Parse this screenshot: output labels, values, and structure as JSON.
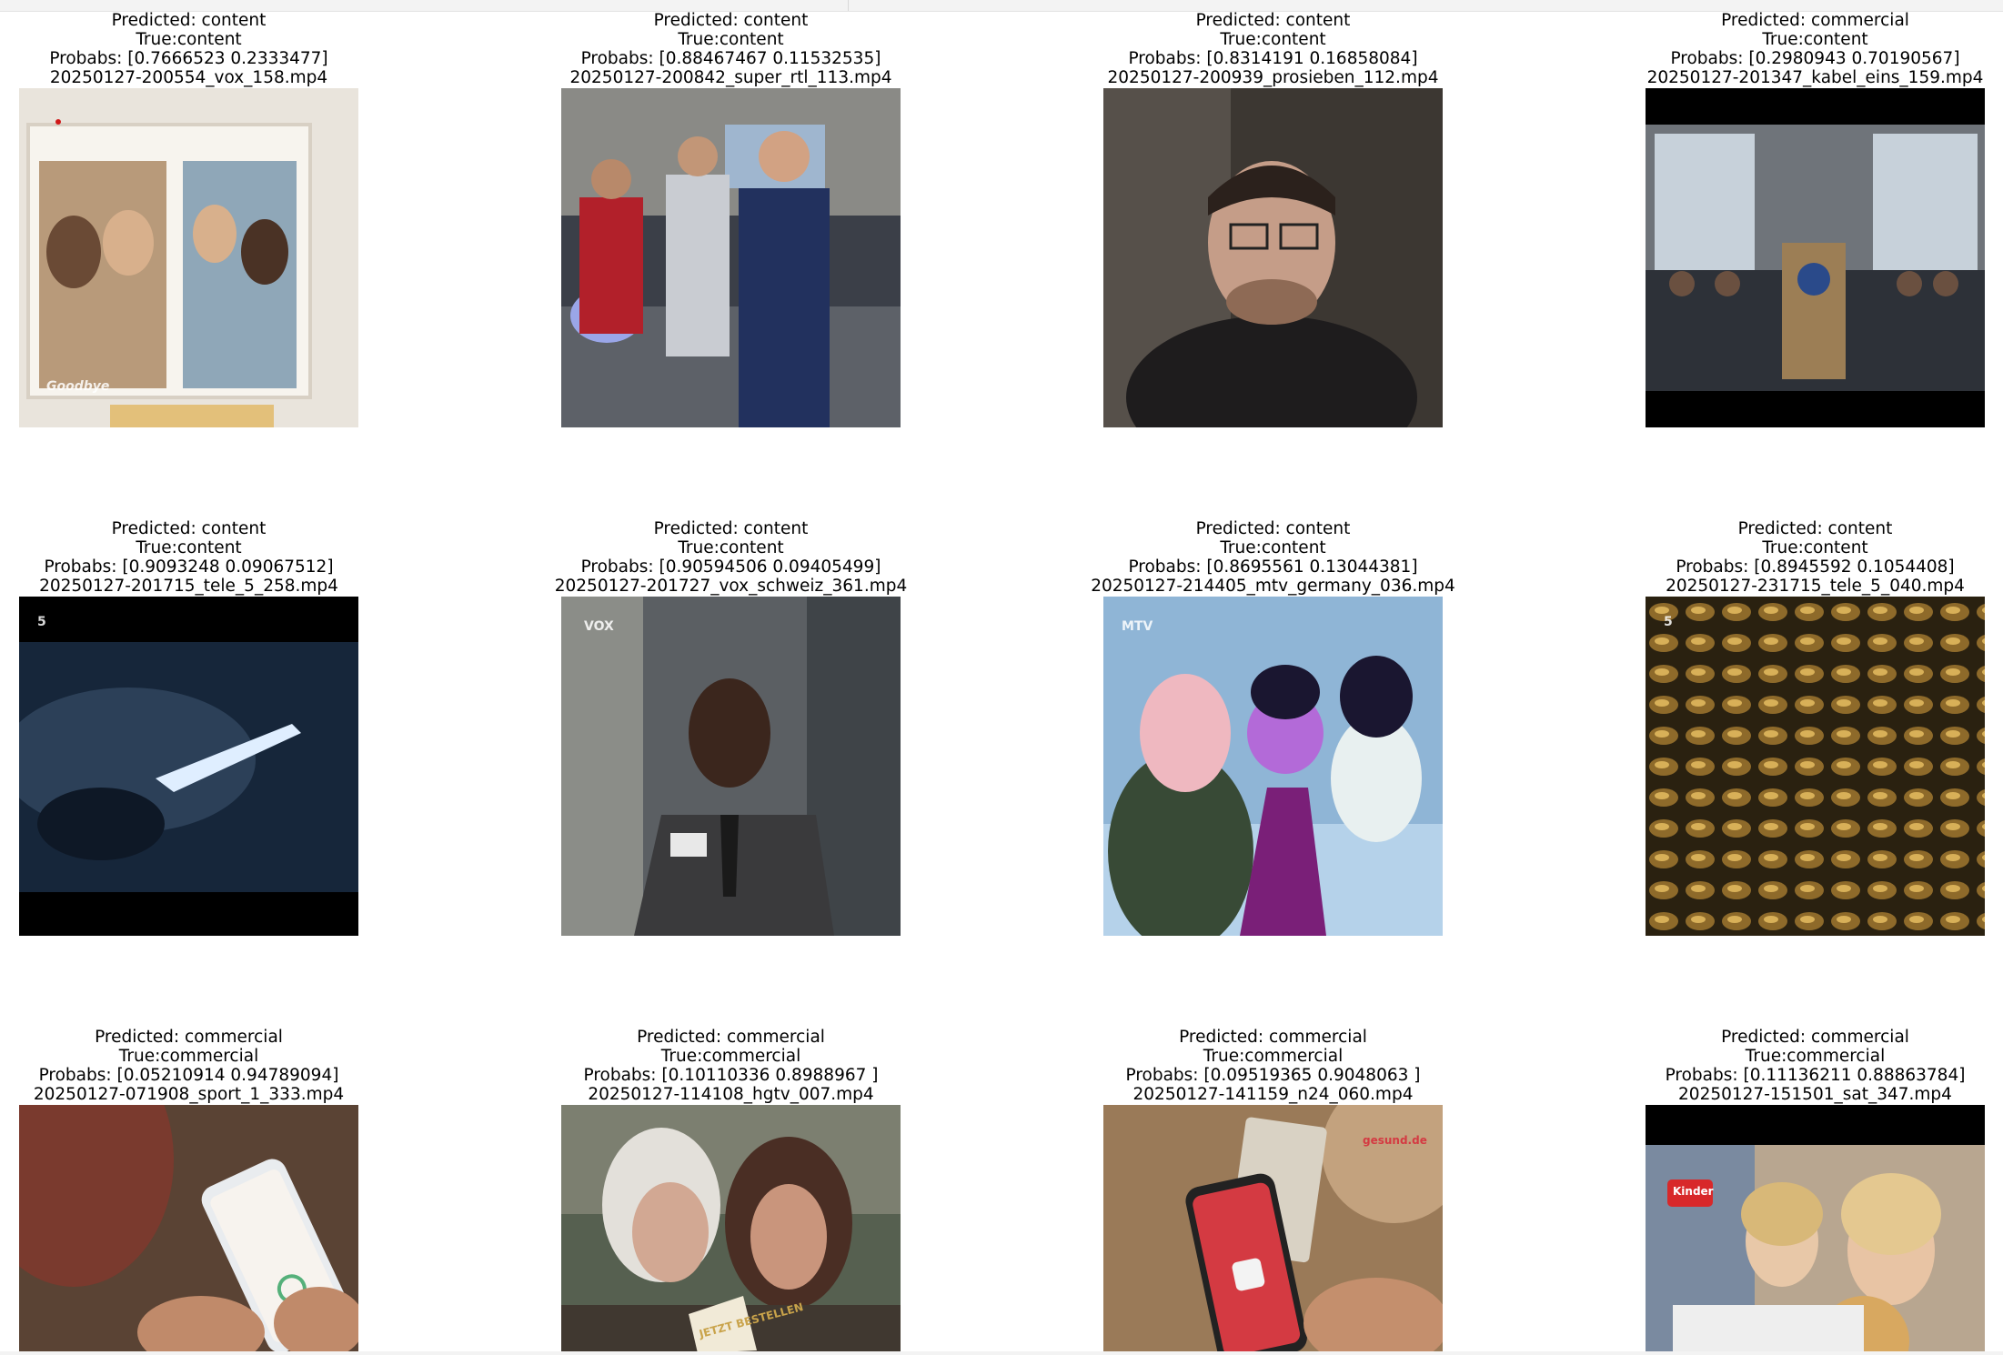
{
  "grid": [
    {
      "predicted": "Predicted: content",
      "true_label": "True:content",
      "probabs": "Probabs: [0.7666523 0.2333477]",
      "filename": "20250127-200554_vox_158.mp4",
      "scene": "photo-frame"
    },
    {
      "predicted": "Predicted: content",
      "true_label": "True:content",
      "probabs": "Probabs: [0.88467467 0.11532535]",
      "filename": "20250127-200842_super_rtl_113.mp4",
      "scene": "lab-three-people"
    },
    {
      "predicted": "Predicted: content",
      "true_label": "True:content",
      "probabs": "Probabs: [0.8314191  0.16858084]",
      "filename": "20250127-200939_prosieben_112.mp4",
      "scene": "man-glasses-portrait"
    },
    {
      "predicted": "Predicted: commercial",
      "true_label": "True:content",
      "probabs": "Probabs: [0.2980943  0.70190567]",
      "filename": "20250127-201347_kabel_eins_159.mp4",
      "scene": "press-conference"
    },
    {
      "predicted": "Predicted: content",
      "true_label": "True:content",
      "probabs": "Probabs: [0.9093248  0.09067512]",
      "filename": "20250127-201715_tele_5_258.mp4",
      "scene": "dark-beam"
    },
    {
      "predicted": "Predicted: content",
      "true_label": "True:content",
      "probabs": "Probabs: [0.90594506 0.09405499]",
      "filename": "20250127-201727_vox_schweiz_361.mp4",
      "scene": "man-suit-id-card"
    },
    {
      "predicted": "Predicted: content",
      "true_label": "True:content",
      "probabs": "Probabs: [0.8695561  0.13044381]",
      "filename": "20250127-214405_mtv_germany_036.mp4",
      "scene": "cartoon"
    },
    {
      "predicted": "Predicted: content",
      "true_label": "True:content",
      "probabs": "Probabs: [0.8945592 0.1054408]",
      "filename": "20250127-231715_tele_5_040.mp4",
      "scene": "gold-pattern"
    },
    {
      "predicted": "Predicted: commercial",
      "true_label": "True:commercial",
      "probabs": "Probabs: [0.05210914 0.94789094]",
      "filename": "20250127-071908_sport_1_333.mp4",
      "scene": "phone-in-hand"
    },
    {
      "predicted": "Predicted: commercial",
      "true_label": "True:commercial",
      "probabs": "Probabs: [0.10110336 0.8988967 ]",
      "filename": "20250127-114108_hgtv_007.mp4",
      "scene": "two-women"
    },
    {
      "predicted": "Predicted: commercial",
      "true_label": "True:commercial",
      "probabs": "Probabs: [0.09519365 0.9048063 ]",
      "filename": "20250127-141159_n24_060.mp4",
      "scene": "red-phone-app"
    },
    {
      "predicted": "Predicted: commercial",
      "true_label": "True:commercial",
      "probabs": "Probabs: [0.11136211 0.88863784]",
      "filename": "20250127-151501_sat_347.mp4",
      "scene": "family-kinder"
    }
  ],
  "watermarks": {
    "goodbye": "Goodbye",
    "vox": "VOX",
    "five": "5",
    "mtv": "MTV",
    "kinder": "Kinder",
    "gesundde": "gesund.de",
    "jetzt": "JETZT BESTELLEN"
  }
}
